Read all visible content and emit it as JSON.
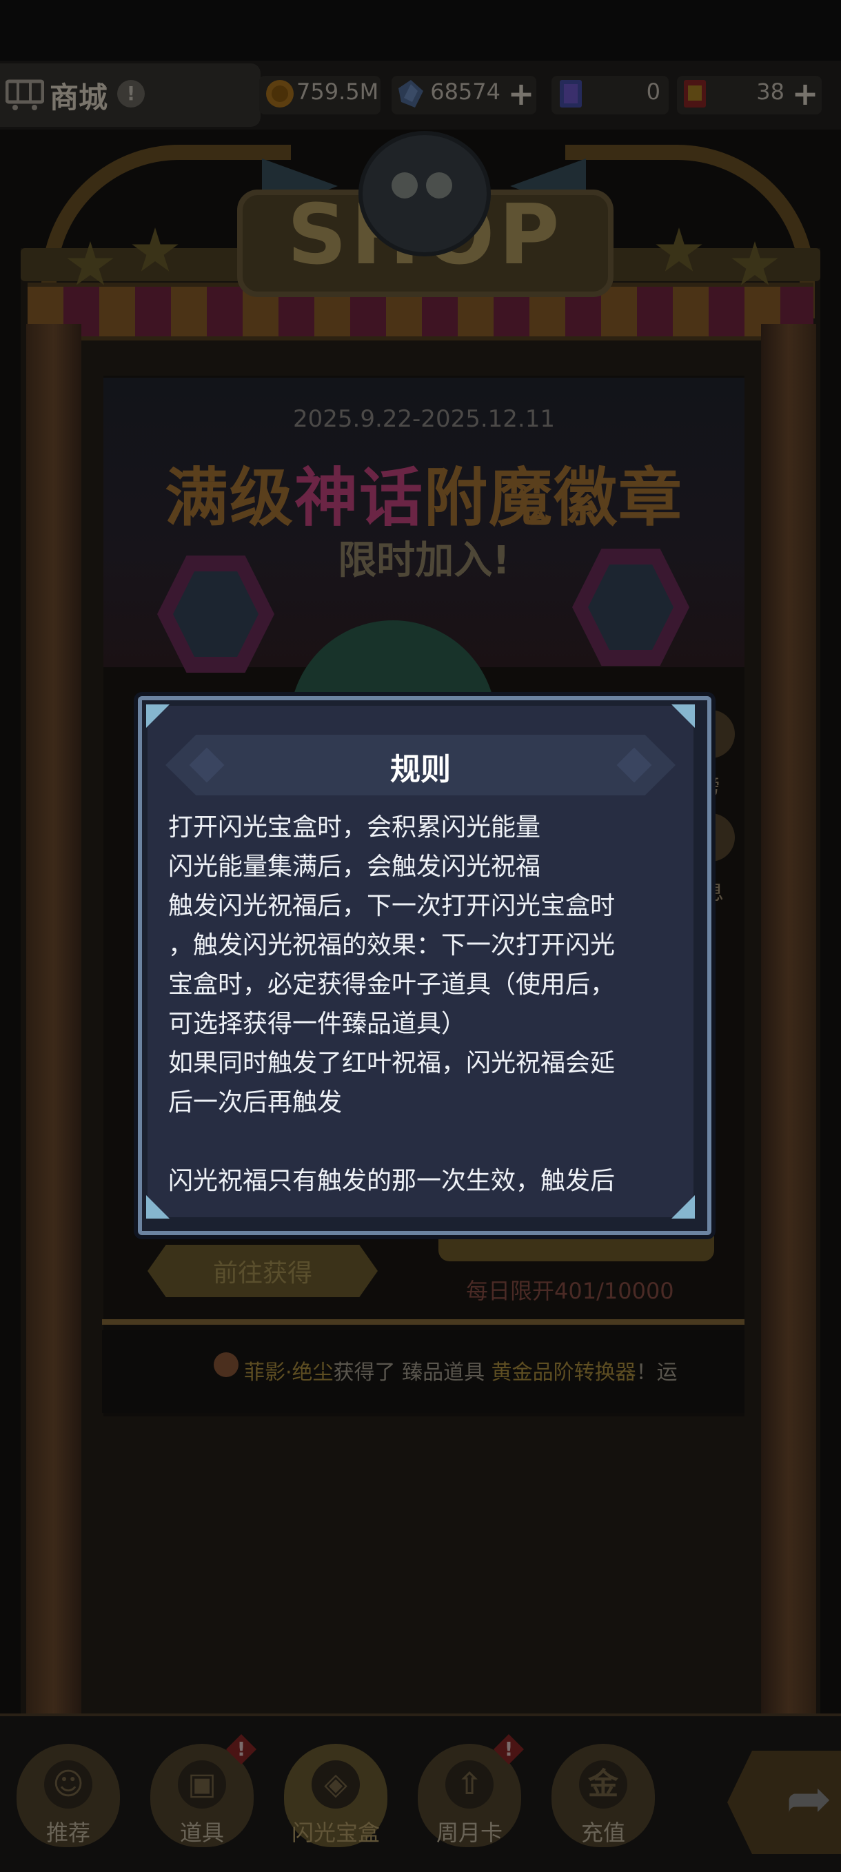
{
  "header": {
    "shop_title": "商城",
    "info_icon": "!",
    "resources": [
      {
        "icon": "gold-coin",
        "value": "759.5M",
        "has_plus": false
      },
      {
        "icon": "blue-crystal",
        "value": "68574",
        "has_plus": true
      },
      {
        "icon": "ticket",
        "value": "0",
        "has_plus": false
      },
      {
        "icon": "gold-card",
        "value": "38",
        "has_plus": true
      }
    ]
  },
  "shop": {
    "sign_text": "SHOP",
    "banner": {
      "date_range": "2025.9.22-2025.12.11",
      "title_a": "满级",
      "title_b": "神话",
      "title_c": "附魔徽章",
      "subtitle": "限时加入!"
    },
    "side_labels": [
      "榜",
      "息"
    ],
    "goto_button": "前往获得",
    "daily_limit": "每日限开401/10000",
    "ticker": {
      "player": "菲影·绝尘",
      "verb": "获得了",
      "item_type": "臻品道具",
      "item_name": "黄金品阶转换器",
      "tail": "！运"
    }
  },
  "dialog": {
    "title": "规则",
    "lines": [
      "打开闪光宝盒时，会积累闪光能量",
      "闪光能量集满后，会触发闪光祝福",
      "触发闪光祝福后，下一次打开闪光宝盒时",
      "，触发闪光祝福的效果：下一次打开闪光",
      "宝盒时，必定获得金叶子道具（使用后，",
      "可选择获得一件臻品道具）",
      "如果同时触发了红叶祝福，闪光祝福会延",
      "后一次后再触发",
      "",
      "闪光祝福只有触发的那一次生效，触发后"
    ]
  },
  "nav": {
    "items": [
      {
        "label": "推荐",
        "glyph": "☺",
        "badge": ""
      },
      {
        "label": "道具",
        "glyph": "▣",
        "badge": "!"
      },
      {
        "label": "闪光宝盒",
        "glyph": "◈",
        "badge": ""
      },
      {
        "label": "周月卡",
        "glyph": "⇧",
        "badge": "!"
      },
      {
        "label": "充值",
        "glyph": "金",
        "badge": ""
      }
    ],
    "share_icon": "share-arrow-icon"
  }
}
